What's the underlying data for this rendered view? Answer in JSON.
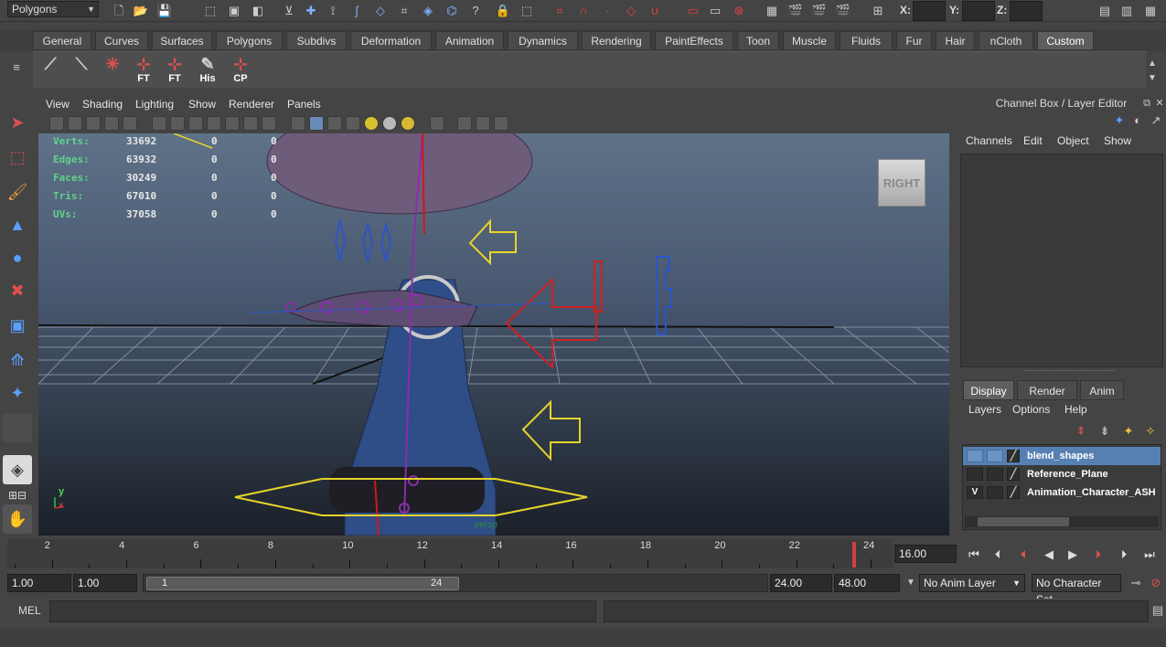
{
  "status_line": {
    "mode_selector": "Polygons",
    "coords": {
      "x_label": "X:",
      "y_label": "Y:",
      "z_label": "Z:"
    }
  },
  "shelf": {
    "tabs": [
      "General",
      "Curves",
      "Surfaces",
      "Polygons",
      "Subdivs",
      "Deformation",
      "Animation",
      "Dynamics",
      "Rendering",
      "PaintEffects",
      "Toon",
      "Muscle",
      "Fluids",
      "Fur",
      "Hair",
      "nCloth",
      "Custom"
    ],
    "active_tab": "Custom",
    "buttons": [
      "",
      "",
      "",
      "FT",
      "FT",
      "His",
      "CP"
    ]
  },
  "viewport": {
    "menu": [
      "View",
      "Shading",
      "Lighting",
      "Show",
      "Renderer",
      "Panels"
    ],
    "hud": [
      {
        "label": "Verts:",
        "value": "33692",
        "sel": "0",
        "comp": "0"
      },
      {
        "label": "Edges:",
        "value": "63932",
        "sel": "0",
        "comp": "0"
      },
      {
        "label": "Faces:",
        "value": "30249",
        "sel": "0",
        "comp": "0"
      },
      {
        "label": "Tris:",
        "value": "67010",
        "sel": "0",
        "comp": "0"
      },
      {
        "label": "UVs:",
        "value": "37058",
        "sel": "0",
        "comp": "0"
      }
    ],
    "view_cube_label": "RIGHT",
    "camera_name": "persp",
    "axis_y": "y",
    "axis_x": "x"
  },
  "channel_box": {
    "title": "Channel Box / Layer Editor",
    "menu": [
      "Channels",
      "Edit",
      "Object",
      "Show"
    ]
  },
  "layer_editor": {
    "tabs": [
      "Display",
      "Render",
      "Anim"
    ],
    "active_tab": "Display",
    "menu": [
      "Layers",
      "Options",
      "Help"
    ],
    "layers": [
      {
        "vis": "",
        "name": "blend_shapes",
        "selected": true
      },
      {
        "vis": "",
        "name": "Reference_Plane",
        "selected": false
      },
      {
        "vis": "V",
        "name": "Animation_Character_ASH",
        "selected": false
      }
    ]
  },
  "time_slider": {
    "tick_labels": [
      "2",
      "4",
      "6",
      "8",
      "10",
      "12",
      "14",
      "16",
      "18",
      "20",
      "22",
      "24"
    ],
    "current_frame": "16.00"
  },
  "range_slider": {
    "anim_start": "1.00",
    "range_start": "1.00",
    "thumb_start": "1",
    "thumb_end": "24",
    "range_end": "24.00",
    "anim_end": "48.00",
    "anim_layer": "No Anim Layer",
    "character_set": "No Character Set"
  },
  "command_line": {
    "label": "MEL"
  },
  "colors": {
    "hud_label": "#5fd38a",
    "layer_selected": "#5680b2",
    "active_tab": "#5d5d5d"
  }
}
